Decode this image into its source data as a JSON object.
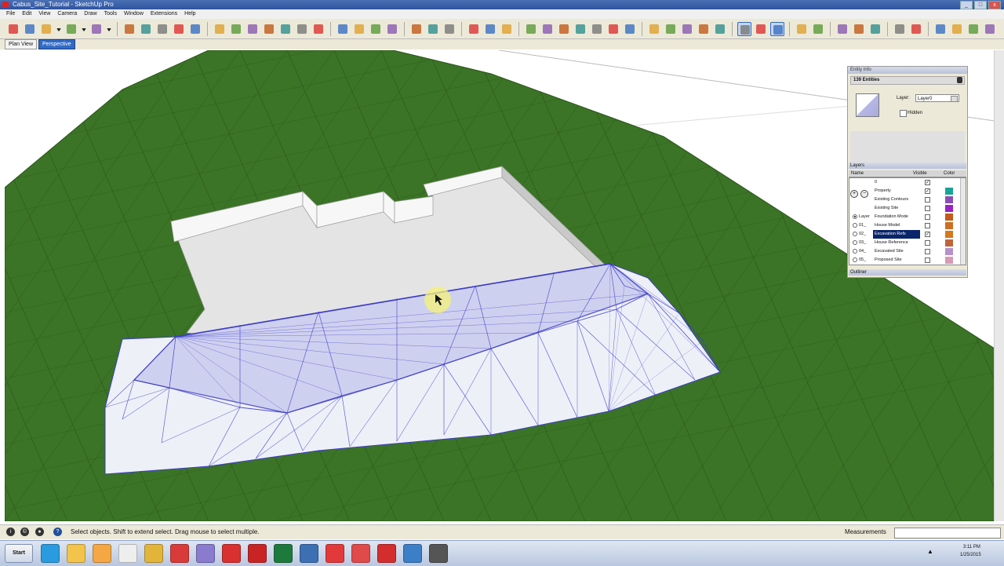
{
  "window": {
    "title": "Cabus_Site_Tutorial - SketchUp Pro",
    "controls": [
      "_",
      "□",
      "x"
    ]
  },
  "menu": [
    "File",
    "Edit",
    "View",
    "Camera",
    "Draw",
    "Tools",
    "Window",
    "Extensions",
    "Help"
  ],
  "toolbar": {
    "groups": [
      [
        "select-tool-icon",
        "eraser-tool-icon",
        "line-tool-icon",
        "dropdown-arrow-icon",
        "arc-tool-icon",
        "dropdown-arrow-icon",
        "rectangle-tool-icon",
        "dropdown-arrow-icon"
      ],
      [
        "push-pull-icon",
        "offset-icon",
        "move-icon",
        "rotate-icon",
        "scale-icon"
      ],
      [
        "tape-measure-icon",
        "dimension-icon",
        "protractor-icon",
        "axes-icon",
        "text-icon",
        "3d-text-icon",
        "paint-bucket-icon"
      ],
      [
        "orbit-icon",
        "pan-icon",
        "zoom-icon",
        "zoom-window-icon"
      ],
      [
        "walk-icon",
        "look-around-icon",
        "position-camera-icon"
      ],
      [
        "section-plane-icon",
        "section-display-icon",
        "section-cut-icon"
      ],
      [
        "sandbox-from-contours-icon",
        "sandbox-from-scratch-icon",
        "smoove-icon",
        "stamp-icon",
        "drape-icon",
        "add-detail-icon",
        "flip-edge-icon"
      ],
      [
        "solid-tools-icon",
        "outer-shell-icon",
        "intersect-icon",
        "union-icon",
        "subtract-icon"
      ],
      [
        "iso-view-icon",
        "top-view-icon",
        "front-view-icon"
      ],
      [
        "ruby-console-icon",
        "grid-icon"
      ],
      [
        "warehouse-icon",
        "extension-warehouse-icon",
        "layout-icon"
      ],
      [
        "style-icon",
        "shadow-icon"
      ],
      [
        "component-icon",
        "materials-icon",
        "layers-icon",
        "scenes-icon"
      ]
    ],
    "active": [
      "front-view-icon",
      "iso-view-icon"
    ]
  },
  "scene_tabs": [
    {
      "label": "Plan View",
      "active": false
    },
    {
      "label": "Perspective",
      "active": true
    }
  ],
  "colors": {
    "terrain": "#3b7426",
    "terrain_grid": "#2b5419",
    "pad": "#e6e6e6",
    "selection": "#3c3cc8",
    "selection_fill": "#c7c9ee"
  },
  "entity_info": {
    "header": "Entity Info",
    "title": "139 Entities",
    "layer_label": "Layer:",
    "layer_value": "Layer0",
    "hidden_label": "Hidden"
  },
  "layers": {
    "header": "Layers",
    "columns": [
      "Name",
      "Visible",
      "Color"
    ],
    "side_label": "Name",
    "rows": [
      {
        "name": "0",
        "visible": true,
        "radio": false,
        "color": "#ffffff",
        "selected": false
      },
      {
        "name": "Property",
        "visible": true,
        "radio": false,
        "color": "#1aa39a",
        "selected": false
      },
      {
        "name": "Existing Contours",
        "visible": false,
        "radio": false,
        "color": "#8b4fb3",
        "selected": false
      },
      {
        "name": "Existing Site",
        "visible": false,
        "radio": false,
        "color": "#9b22c2",
        "selected": false
      },
      {
        "name": "Foundation Mode",
        "visible": false,
        "radio": true,
        "color": "#c45a1a",
        "selected": false
      },
      {
        "name": "House Model",
        "visible": false,
        "radio": false,
        "color": "#cc6f22",
        "selected": false
      },
      {
        "name": "Excavation Refs",
        "visible": true,
        "radio": false,
        "color": "#d6771d",
        "selected": true
      },
      {
        "name": "House Reference",
        "visible": false,
        "radio": false,
        "color": "#c0643a",
        "selected": false
      },
      {
        "name": "Excavated Site",
        "visible": false,
        "radio": false,
        "color": "#b792c9",
        "selected": false
      },
      {
        "name": "Proposed Site",
        "visible": false,
        "radio": false,
        "color": "#d79ab6",
        "selected": false
      }
    ],
    "radio_prefixes": [
      "",
      "",
      "",
      "",
      "Layer",
      "01_",
      "02_",
      "03_",
      "04_",
      "05_"
    ],
    "footer": "Outliner"
  },
  "status": {
    "hint": "Select objects. Shift to extend select. Drag mouse to select multiple.",
    "measurements_label": "Measurements",
    "icons": [
      "geo-location-icon",
      "credits-icon",
      "user-icon",
      "help-icon"
    ]
  },
  "taskbar": {
    "start": "Start",
    "apps": [
      {
        "name": "ie-icon",
        "color": "#2a9be0"
      },
      {
        "name": "folder-icon",
        "color": "#f2c44c"
      },
      {
        "name": "media-icon",
        "color": "#f4a742"
      },
      {
        "name": "calculator-icon",
        "color": "#eeeeee"
      },
      {
        "name": "chrome-icon",
        "color": "#e2b53a"
      },
      {
        "name": "sketchup-alt-icon",
        "color": "#d93b3b"
      },
      {
        "name": "paint-icon",
        "color": "#8a7bcf"
      },
      {
        "name": "filezilla-icon",
        "color": "#d93030"
      },
      {
        "name": "foxit-icon",
        "color": "#c92424"
      },
      {
        "name": "excel-icon",
        "color": "#1e7a3c"
      },
      {
        "name": "snipping-icon",
        "color": "#3d6fb3"
      },
      {
        "name": "sketchup-icon",
        "color": "#e23a3a"
      },
      {
        "name": "layout-app-icon",
        "color": "#e04a4a"
      },
      {
        "name": "style-builder-icon",
        "color": "#d42d2d"
      },
      {
        "name": "desktop-icon",
        "color": "#3d7fc7"
      },
      {
        "name": "tool-icon",
        "color": "#555555"
      }
    ],
    "time": "3:11 PM",
    "date": "1/25/2015"
  }
}
